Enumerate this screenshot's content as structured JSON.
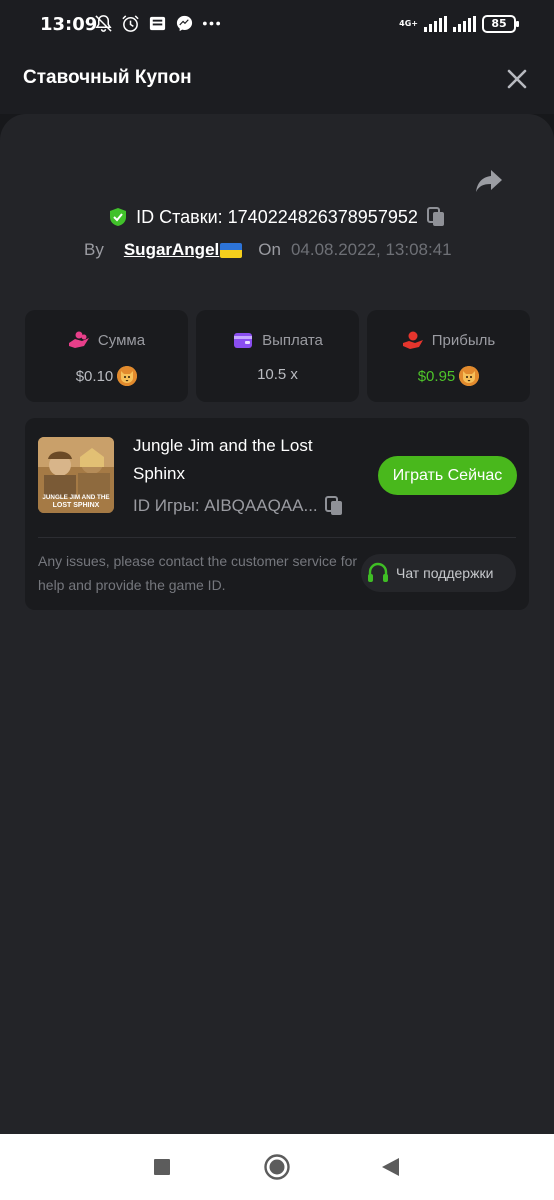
{
  "status_bar": {
    "time": "13:09",
    "network": "4G+",
    "battery": "85",
    "icons": [
      "mute-notification-icon",
      "alarm-icon",
      "news-icon",
      "messenger-icon",
      "more-icon"
    ]
  },
  "header": {
    "title": "Ставочный Купон",
    "close_icon": "close-icon"
  },
  "bet": {
    "id_label": "ID Ставки: 1740224826378957952",
    "by_label": "By",
    "user": "SugarAngel",
    "on_label": "On",
    "date": "04.08.2022, 13:08:41"
  },
  "stats": [
    {
      "label": "Сумма",
      "value": "$0.10",
      "icon": "coins-hand-icon",
      "accent": "#e83f8a"
    },
    {
      "label": "Выплата",
      "value": "10.5 x",
      "icon": "wallet-icon",
      "accent": "#8a4ef0"
    },
    {
      "label": "Прибыль",
      "value": "$0.95",
      "icon": "profit-hand-icon",
      "accent": "#e5352d"
    }
  ],
  "game": {
    "title": "Jungle Jim and the Lost Sphinx",
    "id_label": "ID Игры: AIBQAAQAA...",
    "play_label": "Играть Сейчас",
    "thumb_text_line1": "JUNGLE JIM AND THE",
    "thumb_text_line2": "LOST SPHINX"
  },
  "support": {
    "issue_text": "Any issues, please contact the customer service for help and provide the game ID.",
    "chat_label": "Чат поддержки"
  },
  "colors": {
    "background": "#17181b",
    "panel": "#232428",
    "card": "#1a1b1e",
    "accent_green": "#49b81c",
    "profit_green": "#4ec42a"
  }
}
